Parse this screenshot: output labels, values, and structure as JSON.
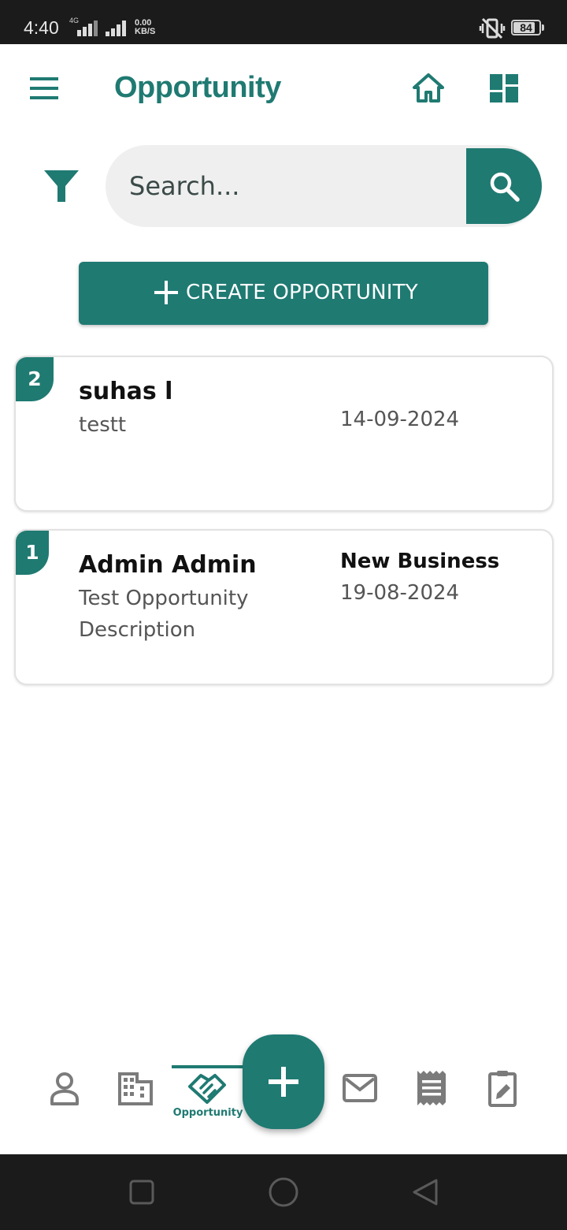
{
  "status_bar": {
    "time": "4:40",
    "network_tag": "4G",
    "speed_value": "0.00",
    "speed_unit": "KB/S",
    "battery": "84",
    "battery_level": 0.84,
    "icons": [
      "signal-icon",
      "vibrate-icon",
      "battery-icon"
    ]
  },
  "header": {
    "title": "Opportunity",
    "icons": [
      "menu-icon",
      "home-icon",
      "dashboard-icon"
    ]
  },
  "search": {
    "placeholder": "Search...",
    "value": "",
    "icons": [
      "filter-icon",
      "search-icon"
    ]
  },
  "create_button": {
    "label": "CREATE OPPORTUNITY",
    "icon": "plus-icon"
  },
  "opportunities": [
    {
      "index": "2",
      "name": "suhas l",
      "description": "testt",
      "type": "",
      "date": "14-09-2024"
    },
    {
      "index": "1",
      "name": "Admin Admin",
      "description": "Test Opportunity Description",
      "type": "New Business",
      "date": "19-08-2024"
    }
  ],
  "bottom_nav": {
    "items": [
      {
        "icon": "contact-icon"
      },
      {
        "icon": "company-icon"
      },
      {
        "icon": "handshake-icon",
        "label": "Opportunity",
        "active": true
      },
      {
        "icon": "add-icon"
      },
      {
        "icon": "mail-icon"
      },
      {
        "icon": "receipt-icon"
      },
      {
        "icon": "task-edit-icon"
      }
    ]
  },
  "colors": {
    "accent": "#1f7a72",
    "status_bar": "#1b1b1b",
    "search_bg": "#efefef"
  }
}
